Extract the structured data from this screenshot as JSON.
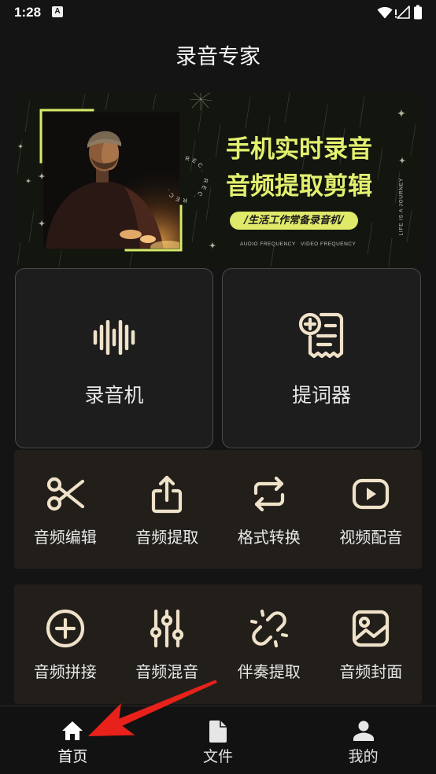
{
  "status_bar": {
    "time": "1:28",
    "notification_glyph": "A",
    "icons": [
      "wifi-icon",
      "no-signal-icon",
      "battery-icon"
    ]
  },
  "header": {
    "title": "录音专家"
  },
  "banner": {
    "headline_1": "手机实时录音",
    "headline_2": "音频提取剪辑",
    "tagline": "/生活工作常备录音机/",
    "caption_left": "AUDIO FREQUENCY",
    "caption_right": "VIDEO FREQUENCY",
    "side_text": "LIFE IS A JOURNEY",
    "badge_text": "REC. REC. REC."
  },
  "main_features": [
    {
      "label": "录音机",
      "icon": "waveform-icon"
    },
    {
      "label": "提词器",
      "icon": "teleprompter-icon"
    }
  ],
  "tool_rows": [
    {
      "items": [
        {
          "label": "音频编辑",
          "icon": "scissors-icon"
        },
        {
          "label": "音频提取",
          "icon": "upload-icon"
        },
        {
          "label": "格式转换",
          "icon": "repeat-icon"
        },
        {
          "label": "视频配音",
          "icon": "play-icon"
        }
      ]
    },
    {
      "items": [
        {
          "label": "音频拼接",
          "icon": "plus-circle-icon"
        },
        {
          "label": "音频混音",
          "icon": "sliders-icon"
        },
        {
          "label": "伴奏提取",
          "icon": "broken-link-icon"
        },
        {
          "label": "音频封面",
          "icon": "image-icon"
        }
      ]
    }
  ],
  "bottom_nav": {
    "items": [
      {
        "label": "首页",
        "icon": "home-icon",
        "active": true
      },
      {
        "label": "文件",
        "icon": "file-icon",
        "active": false
      },
      {
        "label": "我的",
        "icon": "person-icon",
        "active": false
      }
    ]
  },
  "colors": {
    "background": "#141414",
    "card_background": "#1d1d1d",
    "tool_panel_background": "#221f1b",
    "icon": "#efe2c9",
    "banner_accent": "#e3f06f",
    "annotation_arrow": "#e8211b"
  }
}
